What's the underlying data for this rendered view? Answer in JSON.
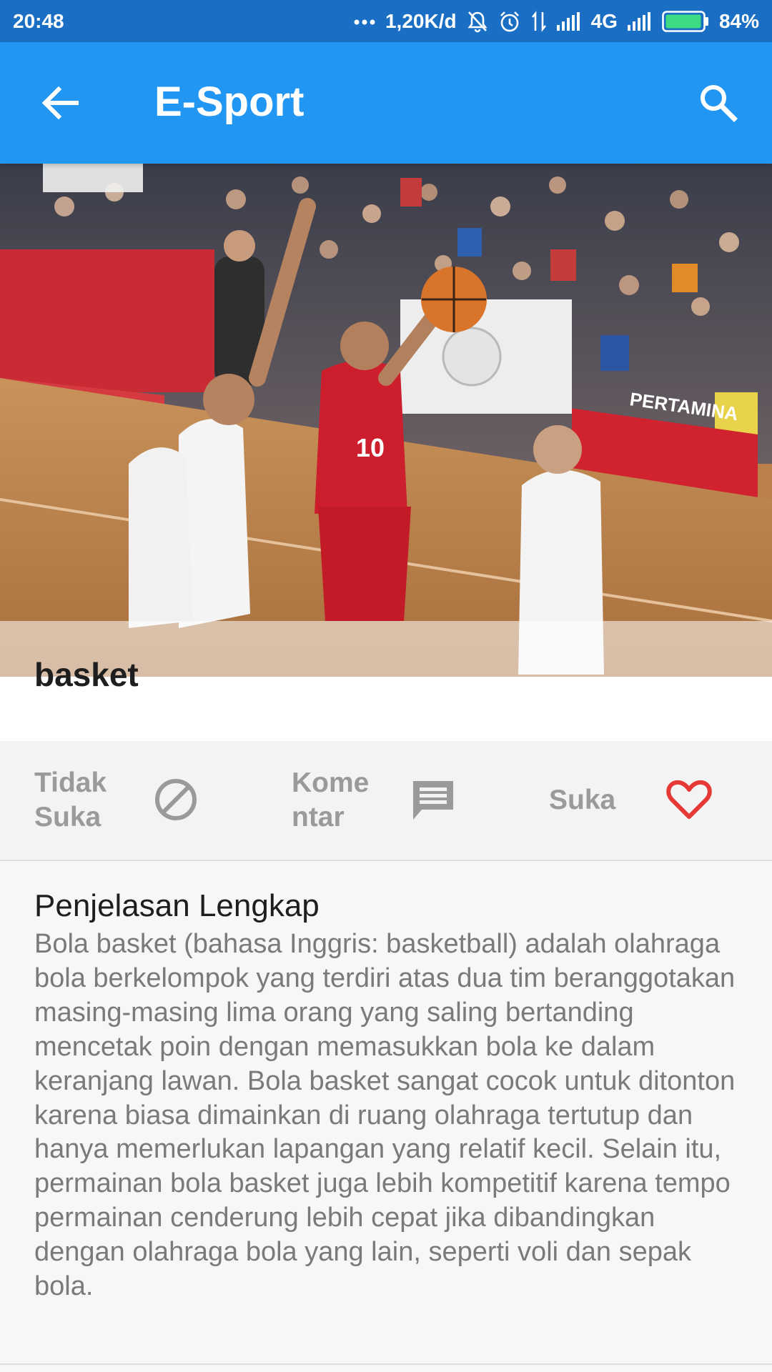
{
  "status_bar": {
    "time": "20:48",
    "network_speed": "1,20K/d",
    "network_type": "4G",
    "battery": "84%",
    "icons": [
      "dots-icon",
      "mute-icon",
      "alarm-icon",
      "data-icon",
      "signal-icon",
      "signal-2-icon",
      "battery-icon"
    ]
  },
  "app_bar": {
    "title": "E-Sport",
    "back_icon": "arrow-back-icon",
    "search_icon": "search-icon"
  },
  "item": {
    "title": "basket",
    "image": "basketball-photo"
  },
  "actions": {
    "dislike": {
      "label": "Tidak\nSuka",
      "icon": "block-icon"
    },
    "comment": {
      "label": "Kome\nntar",
      "icon": "comment-icon"
    },
    "like": {
      "label": "Suka",
      "icon": "heart-icon"
    }
  },
  "description": {
    "heading": "Penjelasan Lengkap",
    "body": "Bola basket (bahasa Inggris: basketball) adalah olahraga bola berkelompok yang terdiri atas dua tim beranggotakan masing-masing lima orang yang saling bertanding mencetak poin dengan memasukkan bola ke dalam keranjang lawan. Bola basket sangat cocok untuk ditonton karena biasa dimainkan di ruang olahraga tertutup dan hanya memerlukan lapangan yang relatif kecil. Selain itu, permainan bola basket juga lebih kompetitif karena tempo permainan cenderung lebih cepat jika dibandingkan dengan olahraga bola yang lain, seperti voli dan sepak bola."
  },
  "colors": {
    "status_bar": "#1a6fc4",
    "app_bar": "#2196f3",
    "heart": "#e53935",
    "muted_text": "#9a9a9a"
  }
}
